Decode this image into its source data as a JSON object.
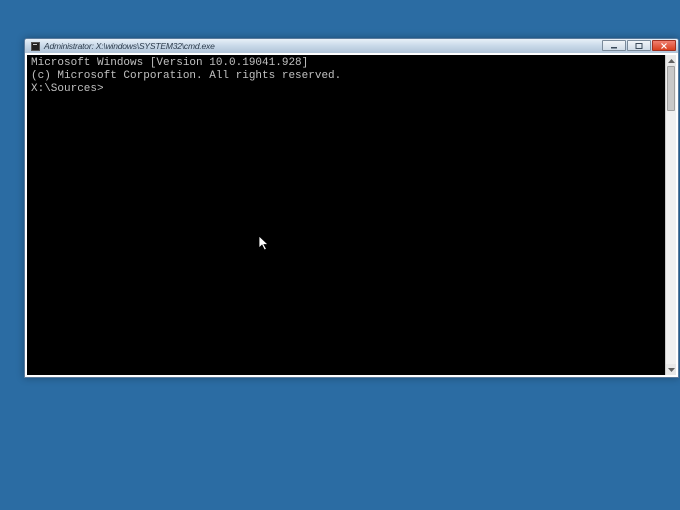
{
  "window": {
    "title": "Administrator: X:\\windows\\SYSTEM32\\cmd.exe",
    "icon_name": "cmd-icon"
  },
  "terminal": {
    "line1": "Microsoft Windows [Version 10.0.19041.928]",
    "line2": "(c) Microsoft Corporation. All rights reserved.",
    "blank": "",
    "prompt": "X:\\Sources>"
  },
  "colors": {
    "desktop": "#2b6ca3",
    "terminal_bg": "#000000",
    "terminal_fg": "#c0c0c0"
  }
}
